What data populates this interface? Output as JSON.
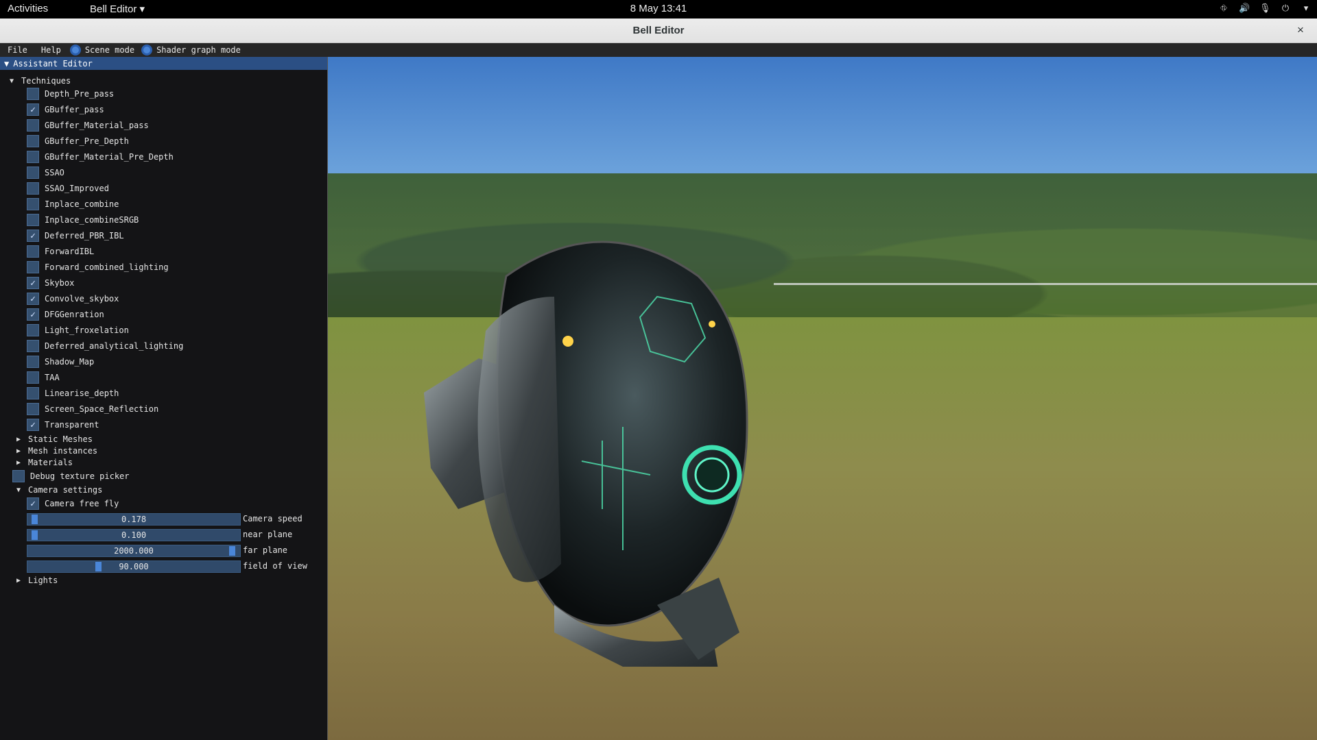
{
  "topbar": {
    "activities": "Activities",
    "app_menu": "Bell Editor ▾",
    "clock": "8 May  13:41",
    "tray_icons": [
      "network-icon",
      "volume-icon",
      "microphone-icon",
      "power-icon",
      "chevron-down-icon"
    ]
  },
  "window": {
    "title": "Bell Editor",
    "close": "×"
  },
  "menubar": {
    "file": "File",
    "help": "Help",
    "scene_mode": "Scene mode",
    "shader_mode": "Shader graph mode"
  },
  "panel": {
    "header": "Assistant Editor",
    "techniques_label": "Techniques",
    "techniques": [
      {
        "label": "Depth_Pre_pass",
        "checked": false
      },
      {
        "label": "GBuffer_pass",
        "checked": true
      },
      {
        "label": "GBuffer_Material_pass",
        "checked": false
      },
      {
        "label": "GBuffer_Pre_Depth",
        "checked": false
      },
      {
        "label": "GBuffer_Material_Pre_Depth",
        "checked": false
      },
      {
        "label": "SSAO",
        "checked": false
      },
      {
        "label": "SSAO_Improved",
        "checked": false
      },
      {
        "label": "Inplace_combine",
        "checked": false
      },
      {
        "label": "Inplace_combineSRGB",
        "checked": false
      },
      {
        "label": "Deferred_PBR_IBL",
        "checked": true
      },
      {
        "label": "ForwardIBL",
        "checked": false
      },
      {
        "label": "Forward_combined_lighting",
        "checked": false
      },
      {
        "label": "Skybox",
        "checked": true
      },
      {
        "label": "Convolve_skybox",
        "checked": true
      },
      {
        "label": "DFGGenration",
        "checked": true
      },
      {
        "label": "Light_froxelation",
        "checked": false
      },
      {
        "label": "Deferred_analytical_lighting",
        "checked": false
      },
      {
        "label": "Shadow_Map",
        "checked": false
      },
      {
        "label": "TAA",
        "checked": false
      },
      {
        "label": "Linearise_depth",
        "checked": false
      },
      {
        "label": "Screen_Space_Reflection",
        "checked": false
      },
      {
        "label": "Transparent",
        "checked": true
      }
    ],
    "static_meshes": "Static Meshes",
    "mesh_instances": "Mesh instances",
    "materials": "Materials",
    "debug_picker": "Debug texture picker",
    "camera_settings": "Camera settings",
    "camera_free_fly": "Camera free fly",
    "sliders": [
      {
        "value": "0.178",
        "label": "Camera speed",
        "fraction": 0.02
      },
      {
        "value": "0.100",
        "label": "near plane",
        "fraction": 0.02
      },
      {
        "value": "2000.000",
        "label": "far plane",
        "fraction": 0.98
      },
      {
        "value": "90.000",
        "label": "field of view",
        "fraction": 0.33
      }
    ],
    "lights": "Lights"
  },
  "colors": {
    "accent": "#4a86d8",
    "panel_bg": "#161618",
    "header_bg": "#2b4f84"
  }
}
